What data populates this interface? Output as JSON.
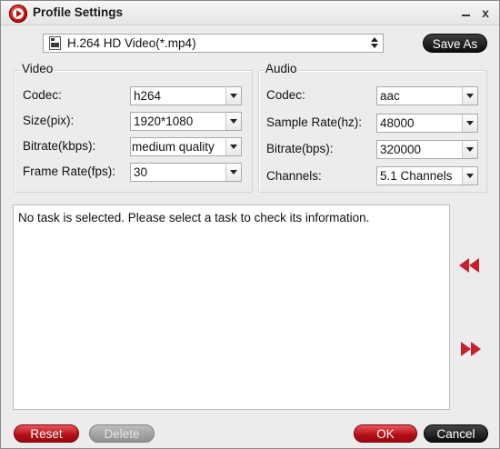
{
  "window": {
    "title": "Profile Settings",
    "minimize_icon": "minimize-icon",
    "close_label": "x"
  },
  "profile": {
    "value": "H.264 HD Video(*.mp4)",
    "icon": "video-file-icon",
    "save_as_label": "Save As"
  },
  "video": {
    "group_label": "Video",
    "codec_label": "Codec:",
    "codec_value": "h264",
    "size_label": "Size(pix):",
    "size_value": "1920*1080",
    "bitrate_label": "Bitrate(kbps):",
    "bitrate_value": "medium quality",
    "framerate_label": "Frame Rate(fps):",
    "framerate_value": "30"
  },
  "audio": {
    "group_label": "Audio",
    "codec_label": "Codec:",
    "codec_value": "aac",
    "samplerate_label": "Sample Rate(hz):",
    "samplerate_value": "48000",
    "bitrate_label": "Bitrate(bps):",
    "bitrate_value": "320000",
    "channels_label": "Channels:",
    "channels_value": "5.1 Channels"
  },
  "info": {
    "message": "No task is selected. Please select a task to check its information."
  },
  "footer": {
    "reset_label": "Reset",
    "delete_label": "Delete",
    "ok_label": "OK",
    "cancel_label": "Cancel"
  },
  "colors": {
    "accent_red": "#c8202a",
    "dark_button": "#0d0d0d",
    "disabled_button": "#8f8f8f"
  }
}
